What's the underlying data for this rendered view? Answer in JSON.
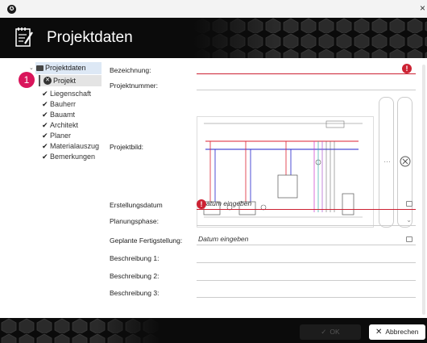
{
  "header": {
    "title": "Projektdaten"
  },
  "sidebar": {
    "root": "Projektdaten",
    "selected": "Projekt",
    "items": [
      "Liegenschaft",
      "Bauherr",
      "Bauamt",
      "Architekt",
      "Planer",
      "Materialauszug",
      "Bemerkungen"
    ],
    "badge": "1"
  },
  "form": {
    "bezeichnung": {
      "label": "Bezeichnung:",
      "value": ""
    },
    "projektnummer": {
      "label": "Projektnummer:",
      "value": ""
    },
    "projektbild": {
      "label": "Projektbild:"
    },
    "erstellungsdatum": {
      "label": "Erstellungsdatum",
      "placeholder": "Datum eingeben",
      "visible_placeholder": "atum eingeben"
    },
    "planungsphase": {
      "label": "Planungsphase:",
      "value": ""
    },
    "fertigstellung": {
      "label": "Geplante Fertigstellung:",
      "placeholder": "Datum eingeben"
    },
    "beschreibung1": {
      "label": "Beschreibung 1:",
      "value": ""
    },
    "beschreibung2": {
      "label": "Beschreibung 2:",
      "value": ""
    },
    "beschreibung3": {
      "label": "Beschreibung 3:",
      "value": ""
    }
  },
  "footer": {
    "ok_label": "OK",
    "cancel_label": "Abbrechen"
  },
  "colors": {
    "accent": "#d9155b",
    "error": "#cc2233",
    "header_bg": "#0b0b0b"
  }
}
